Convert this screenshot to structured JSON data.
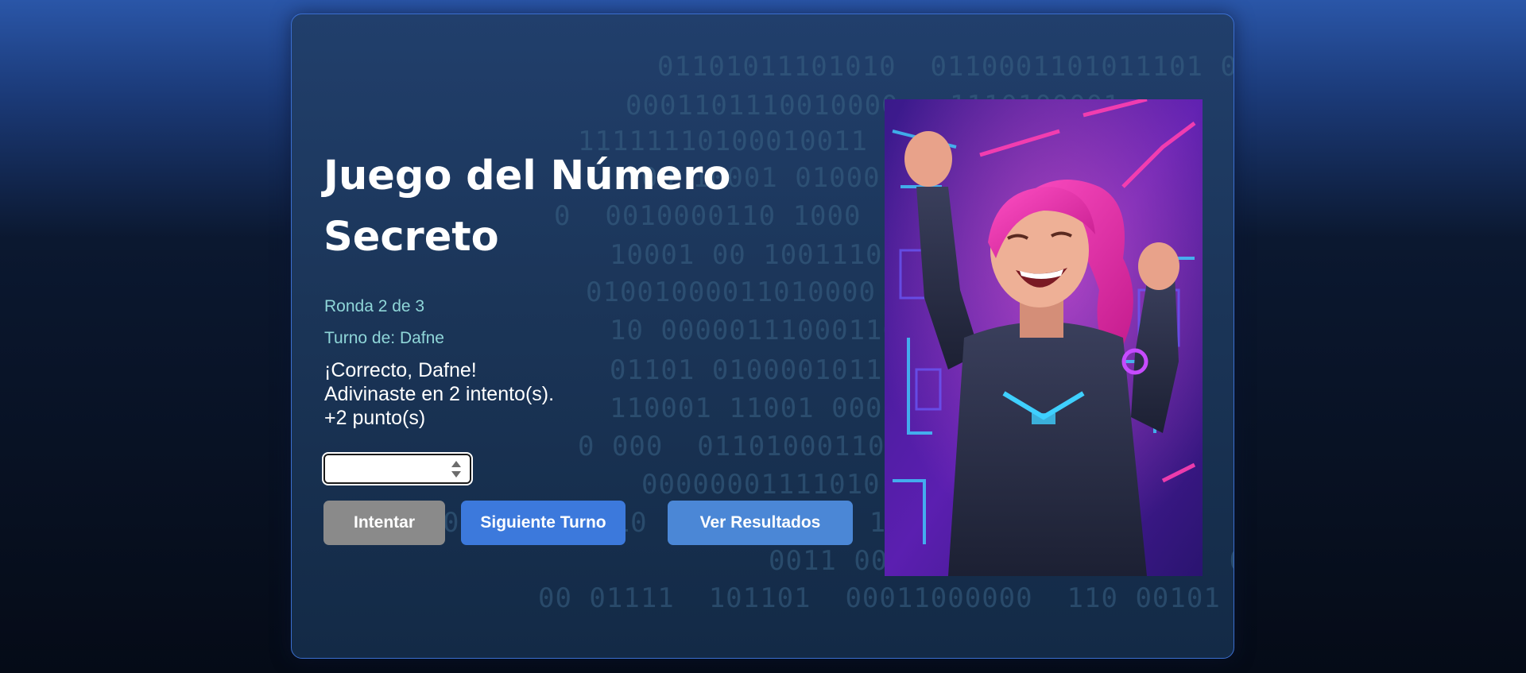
{
  "game": {
    "title": "Juego del Número Secreto",
    "round": "Ronda 2 de 3",
    "turn": "Turno de: Dafne",
    "message_lines": [
      "¡Correcto, Dafne!",
      "Adivinaste en 2 intento(s).",
      "+2 punto(s)"
    ]
  },
  "guess_input": {
    "value": "",
    "placeholder": ""
  },
  "buttons": {
    "try": "Intentar",
    "next_turn": "Siguiente Turno",
    "results": "Ver Resultados"
  },
  "colors": {
    "accent_label": "#8fd6d8",
    "button_disabled": "#8a8a8a",
    "button_primary": "#3c79dc",
    "button_secondary": "#4b87d6",
    "card_border": "#3b6fd0"
  },
  "hero_image": {
    "subject": "celebrating-woman-pink-hair-cyber-armor",
    "icon": "celebration-illustration"
  }
}
